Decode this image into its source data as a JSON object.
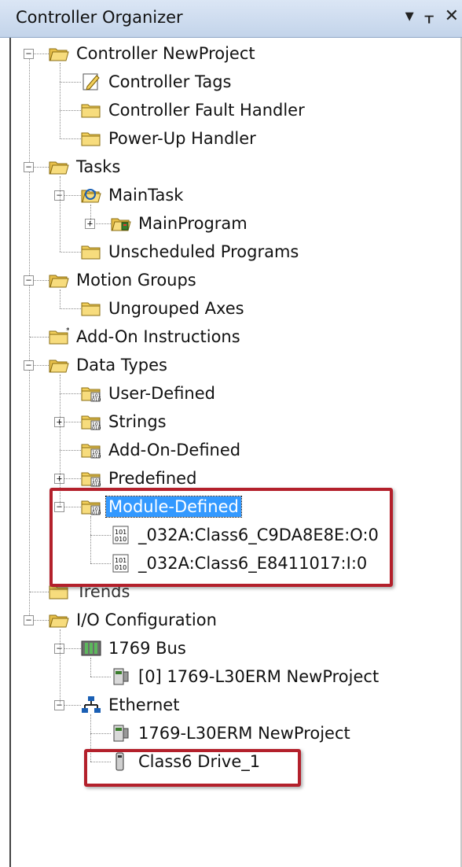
{
  "window": {
    "title": "Controller Organizer",
    "controls": [
      "▾",
      "ᚁ",
      "✕"
    ]
  },
  "tree": [
    {
      "label": "Controller NewProject",
      "icon": "folder-open-icon",
      "level": 0,
      "expander": "minus"
    },
    {
      "label": "Controller Tags",
      "icon": "tags-icon",
      "level": 1
    },
    {
      "label": "Controller Fault Handler",
      "icon": "folder-icon",
      "level": 1
    },
    {
      "label": "Power-Up Handler",
      "icon": "folder-icon",
      "level": 1
    },
    {
      "label": "Tasks",
      "icon": "folder-open-icon",
      "level": 0,
      "expander": "minus"
    },
    {
      "label": "MainTask",
      "icon": "task-icon",
      "level": 1,
      "expander": "minus"
    },
    {
      "label": "MainProgram",
      "icon": "program-icon",
      "level": 2,
      "expander": "plus"
    },
    {
      "label": "Unscheduled Programs",
      "icon": "folder-icon",
      "level": 1
    },
    {
      "label": "Motion Groups",
      "icon": "folder-open-icon",
      "level": 0,
      "expander": "minus"
    },
    {
      "label": "Ungrouped Axes",
      "icon": "folder-icon",
      "level": 1
    },
    {
      "label": "Add-On Instructions",
      "icon": "folder-new-icon",
      "level": 0
    },
    {
      "label": "Data Types",
      "icon": "folder-open-icon",
      "level": 0,
      "expander": "minus"
    },
    {
      "label": "User-Defined",
      "icon": "datatype-folder-icon",
      "level": 1
    },
    {
      "label": "Strings",
      "icon": "datatype-folder-icon",
      "level": 1,
      "expander": "plus"
    },
    {
      "label": "Add-On-Defined",
      "icon": "datatype-folder-icon",
      "level": 1
    },
    {
      "label": "Predefined",
      "icon": "datatype-folder-icon",
      "level": 1,
      "expander": "plus"
    },
    {
      "label": "Module-Defined",
      "icon": "datatype-folder-icon",
      "level": 1,
      "expander": "minus",
      "selected": true
    },
    {
      "label": "_032A:Class6_C9DA8E8E:O:0",
      "icon": "datatype-icon",
      "level": 2
    },
    {
      "label": "_032A:Class6_E8411017:I:0",
      "icon": "datatype-icon",
      "level": 2
    },
    {
      "label": "Trends",
      "icon": "folder-icon",
      "level": 0
    },
    {
      "label": "I/O Configuration",
      "icon": "folder-open-icon",
      "level": 0,
      "expander": "minus"
    },
    {
      "label": "1769 Bus",
      "icon": "bus-icon",
      "level": 1,
      "expander": "minus"
    },
    {
      "label": "[0] 1769-L30ERM NewProject",
      "icon": "controller-icon",
      "level": 2
    },
    {
      "label": "Ethernet",
      "icon": "network-icon",
      "level": 1,
      "expander": "minus"
    },
    {
      "label": "1769-L30ERM NewProject",
      "icon": "controller-icon",
      "level": 2
    },
    {
      "label": "Class6 Drive_1",
      "icon": "drive-icon",
      "level": 2
    }
  ],
  "highlight_color": "#b3202b",
  "selection_color": "#3399ff"
}
